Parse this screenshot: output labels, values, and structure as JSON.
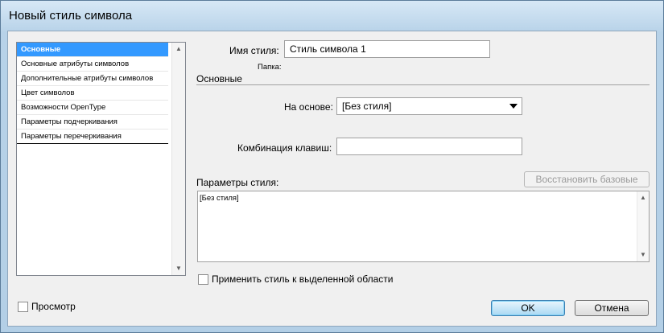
{
  "window": {
    "title": "Новый стиль символа"
  },
  "sidebar": {
    "items": [
      {
        "label": "Основные",
        "selected": true
      },
      {
        "label": "Основные атрибуты символов"
      },
      {
        "label": "Дополнительные атрибуты символов"
      },
      {
        "label": "Цвет символов"
      },
      {
        "label": "Возможности OpenType"
      },
      {
        "label": "Параметры подчеркивания"
      },
      {
        "label": "Параметры перечеркивания"
      }
    ],
    "scroll_up_icon": "▲",
    "scroll_down_icon": "▼"
  },
  "form": {
    "style_name_label": "Имя стиля:",
    "style_name_value": "Стиль символа 1",
    "folder_label": "Папка:",
    "section_title": "Основные",
    "based_on_label": "На основе:",
    "based_on_value": "[Без стиля]",
    "shortcut_label": "Комбинация клавиш:",
    "shortcut_value": "",
    "style_settings_label": "Параметры стиля:",
    "reset_button": "Восстановить базовые",
    "style_settings_value": "[Без стиля]",
    "apply_label": "Применить стиль к выделенной области",
    "apply_checked": false
  },
  "footer": {
    "preview_label": "Просмотр",
    "preview_checked": false,
    "ok_button": "OK",
    "cancel_button": "Отмена"
  }
}
